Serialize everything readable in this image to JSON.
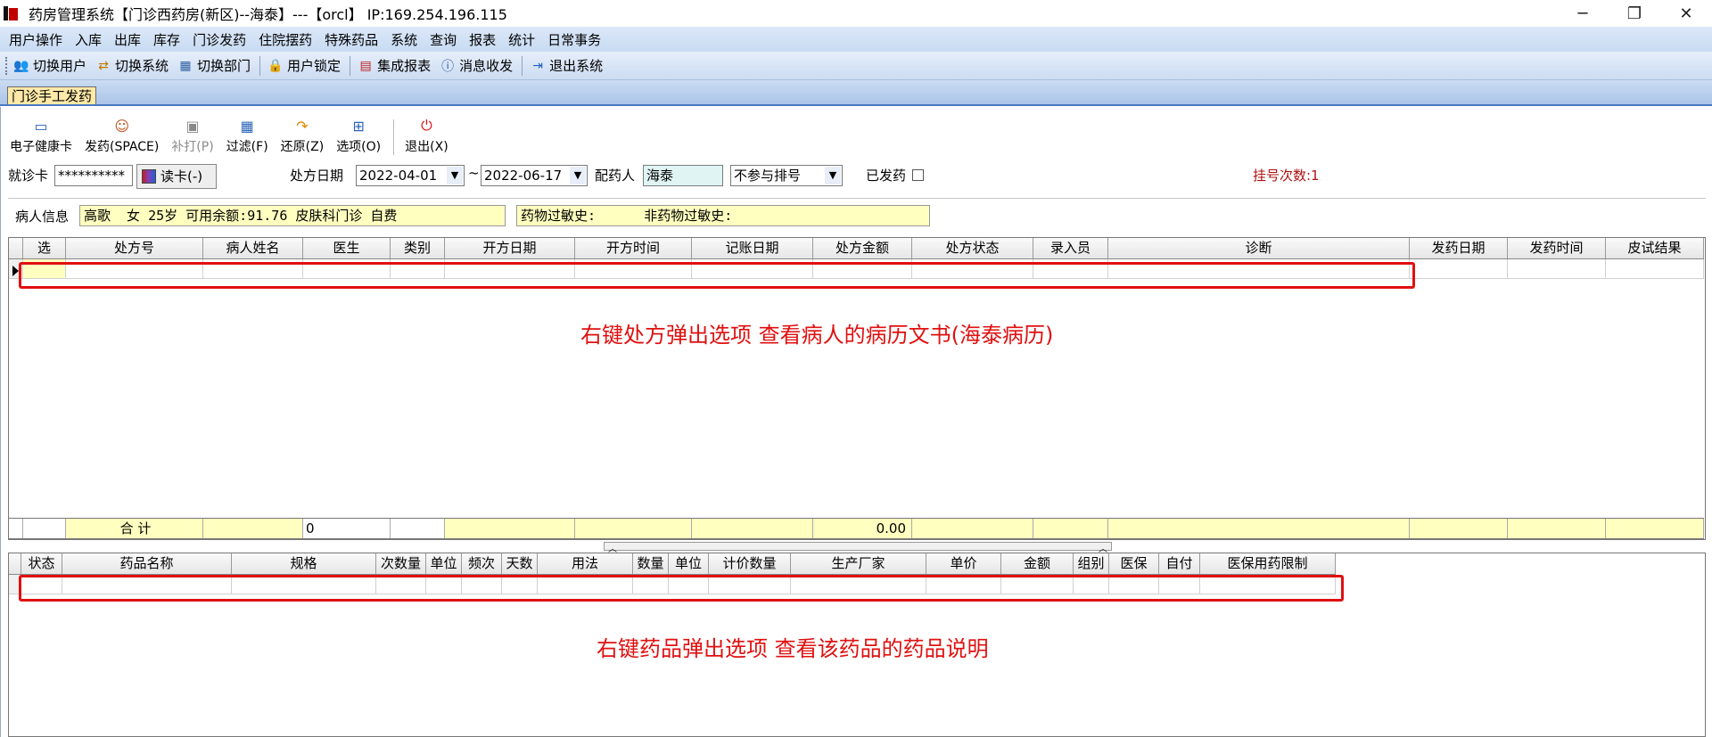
{
  "window": {
    "title": "药房管理系统【门诊西药房(新区)--海泰】---【orcl】 IP:169.254.196.115",
    "controls": {
      "minimize": "─",
      "maximize": "❐",
      "close": "✕"
    }
  },
  "menu": [
    "用户操作",
    "入库",
    "出库",
    "库存",
    "门诊发药",
    "住院摆药",
    "特殊药品",
    "系统",
    "查询",
    "报表",
    "统计",
    "日常事务"
  ],
  "toolbar": [
    {
      "label": "切换用户",
      "icon": "users-icon"
    },
    {
      "label": "切换系统",
      "icon": "switch-system-icon"
    },
    {
      "label": "切换部门",
      "icon": "department-icon"
    },
    {
      "label": "用户锁定",
      "icon": "user-lock-icon"
    },
    {
      "label": "集成报表",
      "icon": "report-icon"
    },
    {
      "label": "消息收发",
      "icon": "message-icon"
    },
    {
      "label": "退出系统",
      "icon": "exit-icon"
    }
  ],
  "tab": {
    "label": "门诊手工发药"
  },
  "actions": [
    {
      "label": "电子健康卡",
      "icon": "health-card-icon",
      "enabled": true
    },
    {
      "label": "发药(SPACE)",
      "icon": "dispense-icon",
      "enabled": true
    },
    {
      "label": "补打(P)",
      "icon": "printer-icon",
      "enabled": false
    },
    {
      "label": "过滤(F)",
      "icon": "filter-icon",
      "enabled": true
    },
    {
      "label": "还原(Z)",
      "icon": "undo-icon",
      "enabled": true
    },
    {
      "label": "选项(O)",
      "icon": "options-icon",
      "enabled": true
    },
    {
      "label": "退出(X)",
      "icon": "power-icon",
      "enabled": true
    }
  ],
  "filters": {
    "card_label": "就诊卡",
    "card_value": "**********",
    "read_card_label": "读卡(-)",
    "date_label": "处方日期",
    "date_from": "2022-04-01",
    "date_sep": "~",
    "date_to": "2022-06-17",
    "pharmacist_label": "配药人",
    "pharmacist_value": "海泰",
    "queue_value": "不参与排号",
    "dispensed_label": "已发药",
    "register_count": "挂号次数:1"
  },
  "patient": {
    "label": "病人信息",
    "info": "高歌  女 25岁 可用余额:91.76 皮肤科门诊 自费",
    "allergy": "药物过敏史:      非药物过敏史:"
  },
  "prescription_table": {
    "columns": [
      "选",
      "处方号",
      "病人姓名",
      "医生",
      "类别",
      "开方日期",
      "开方时间",
      "记账日期",
      "处方金额",
      "处方状态",
      "录入员",
      "诊断",
      "发药日期",
      "发药时间",
      "皮试结果"
    ],
    "summary": {
      "label": "合  计",
      "count": "0",
      "amount": "0.00"
    }
  },
  "drug_table": {
    "columns": [
      "状态",
      "药品名称",
      "规格",
      "次数量",
      "单位",
      "频次",
      "天数",
      "用法",
      "数量",
      "单位",
      "计价数量",
      "生产厂家",
      "单价",
      "金额",
      "组别",
      "医保",
      "自付",
      "医保用药限制"
    ]
  },
  "annotations": {
    "prescription": "右键处方弹出选项 查看病人的病历文书(海泰病历)",
    "drug": "右键药品弹出选项 查看该药品的药品说明"
  },
  "colors": {
    "annotation": "#e01010",
    "field_bg": "#ffffc0",
    "tab_bg": "#ffe9a8"
  }
}
